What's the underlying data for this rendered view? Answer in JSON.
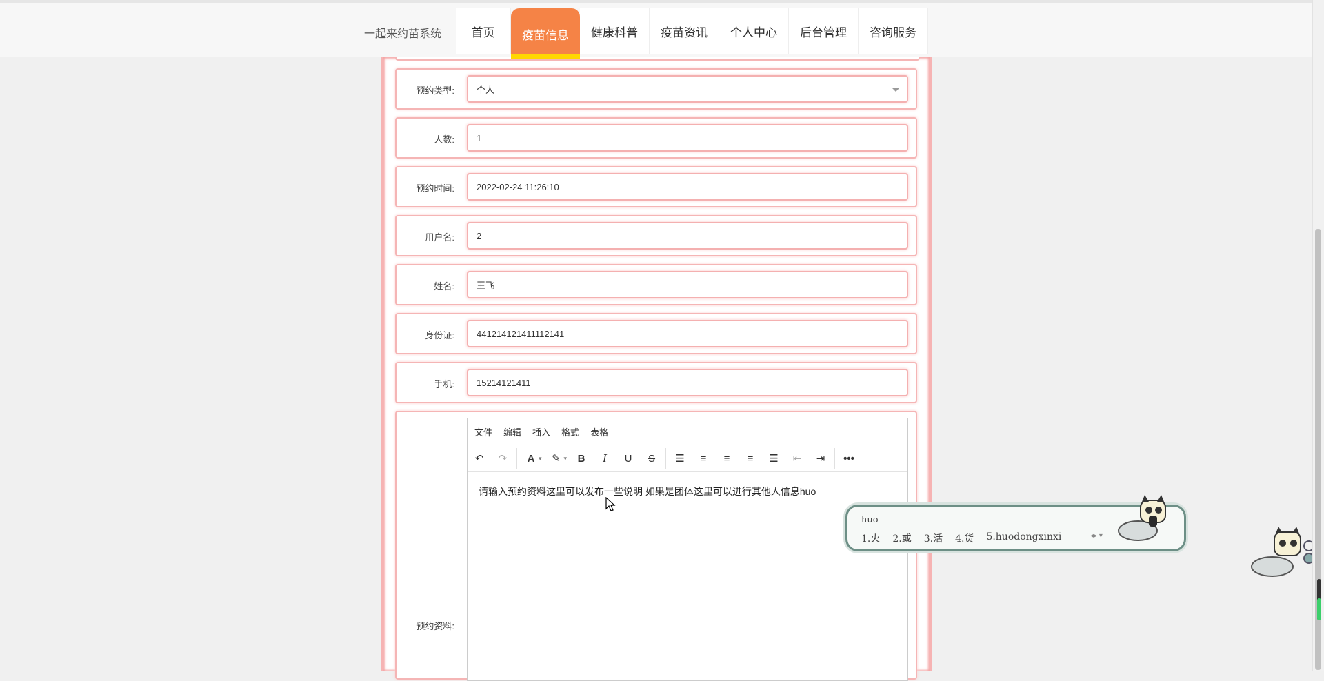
{
  "site": {
    "name": "一起来约苗系统"
  },
  "nav": [
    {
      "label": "首页",
      "active": false
    },
    {
      "label": "疫苗信息",
      "active": true
    },
    {
      "label": "健康科普",
      "active": false
    },
    {
      "label": "疫苗资讯",
      "active": false
    },
    {
      "label": "个人中心",
      "active": false
    },
    {
      "label": "后台管理",
      "active": false
    },
    {
      "label": "咨询服务",
      "active": false
    }
  ],
  "form": {
    "booking_type": {
      "label": "预约类型:",
      "value": "个人"
    },
    "count": {
      "label": "人数:",
      "value": "1"
    },
    "booking_time": {
      "label": "预约时间:",
      "value": "2022-02-24 11:26:10"
    },
    "username": {
      "label": "用户名:",
      "value": "2"
    },
    "name": {
      "label": "姓名:",
      "value": "王飞"
    },
    "id_card": {
      "label": "身份证:",
      "value": "441214121411112141"
    },
    "phone": {
      "label": "手机:",
      "value": "15214121411"
    },
    "materials": {
      "label": "预约资料:"
    }
  },
  "editor": {
    "menus": [
      "文件",
      "编辑",
      "插入",
      "格式",
      "表格"
    ],
    "content": "请输入预约资料这里可以发布一些说明 如果是团体这里可以进行其他人信息huo"
  },
  "ime": {
    "composition": "huo",
    "candidates": [
      "1.火",
      "2.或",
      "3.活",
      "4.货",
      "5.huodongxinxi"
    ]
  },
  "colors": {
    "accent": "#f58346",
    "active_underline": "#ffd700",
    "border_pink": "#f5b5b5"
  }
}
